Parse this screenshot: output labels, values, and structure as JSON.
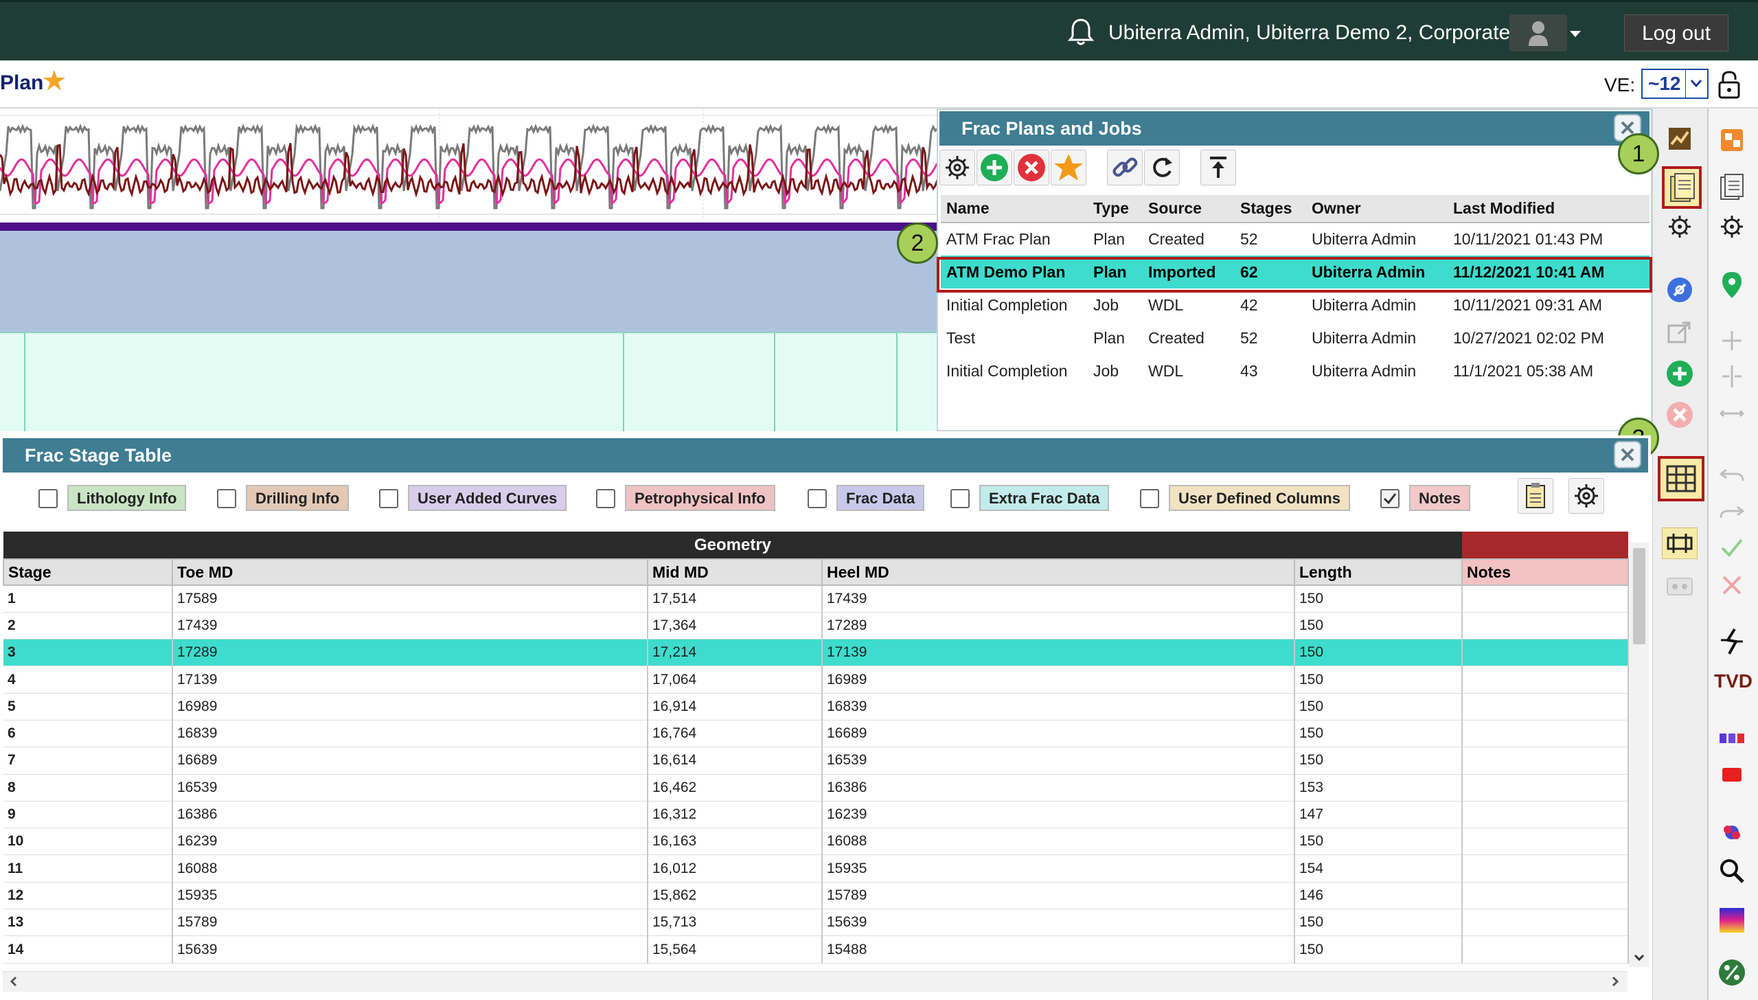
{
  "topbar": {
    "user": "Ubiterra Admin, Ubiterra Demo 2, Corporate",
    "logout_label": "Log out",
    "icons": [
      "bell-icon",
      "avatar-icon",
      "chevron-down-icon"
    ]
  },
  "titlebar": {
    "title": "Plan",
    "ve_label": "VE:",
    "ve_value": "~12"
  },
  "frac_plans": {
    "title": "Frac Plans and Jobs",
    "toolbar_icons": [
      "gear-icon",
      "add-icon",
      "delete-icon",
      "star-icon",
      "link-icon",
      "refresh-icon",
      "upload-icon"
    ],
    "columns": [
      "Name",
      "Type",
      "Source",
      "Stages",
      "Owner",
      "Last Modified"
    ],
    "rows": [
      [
        "ATM Frac Plan",
        "Plan",
        "Created",
        "52",
        "Ubiterra Admin",
        "10/11/2021 01:43 PM"
      ],
      [
        "ATM Demo Plan",
        "Plan",
        "Imported",
        "62",
        "Ubiterra Admin",
        "11/12/2021 10:41 AM"
      ],
      [
        "Initial Completion",
        "Job",
        "WDL",
        "42",
        "Ubiterra Admin",
        "10/11/2021 09:31 AM"
      ],
      [
        "Test",
        "Plan",
        "Created",
        "52",
        "Ubiterra Admin",
        "10/27/2021 02:02 PM"
      ],
      [
        "Initial Completion",
        "Job",
        "WDL",
        "43",
        "Ubiterra Admin",
        "11/1/2021 05:38 AM"
      ]
    ],
    "selected_row": 1
  },
  "callouts": [
    "1",
    "2",
    "3"
  ],
  "stage_table": {
    "title": "Frac Stage Table",
    "filters": [
      {
        "label": "Lithology Info",
        "checked": false,
        "color": "#c9e4c3"
      },
      {
        "label": "Drilling Info",
        "checked": false,
        "color": "#e3c9b5"
      },
      {
        "label": "User Added Curves",
        "checked": false,
        "color": "#d8cdea"
      },
      {
        "label": "Petrophysical Info",
        "checked": false,
        "color": "#efc3c3"
      },
      {
        "label": "Frac Data",
        "checked": false,
        "color": "#c8c9ea"
      },
      {
        "label": "Extra Frac Data",
        "checked": false,
        "color": "#c1ecea"
      },
      {
        "label": "User Defined Columns",
        "checked": false,
        "color": "#f1e3c1"
      },
      {
        "label": "Notes",
        "checked": true,
        "color": "#f3c8c8"
      }
    ],
    "group_header": "Geometry",
    "columns": [
      "Stage",
      "Toe MD",
      "Mid MD",
      "Heel MD",
      "Length",
      "Notes"
    ],
    "rows": [
      [
        "1",
        "17589",
        "17,514",
        "17439",
        "150",
        ""
      ],
      [
        "2",
        "17439",
        "17,364",
        "17289",
        "150",
        ""
      ],
      [
        "3",
        "17289",
        "17,214",
        "17139",
        "150",
        ""
      ],
      [
        "4",
        "17139",
        "17,064",
        "16989",
        "150",
        ""
      ],
      [
        "5",
        "16989",
        "16,914",
        "16839",
        "150",
        ""
      ],
      [
        "6",
        "16839",
        "16,764",
        "16689",
        "150",
        ""
      ],
      [
        "7",
        "16689",
        "16,614",
        "16539",
        "150",
        ""
      ],
      [
        "8",
        "16539",
        "16,462",
        "16386",
        "153",
        ""
      ],
      [
        "9",
        "16386",
        "16,312",
        "16239",
        "147",
        ""
      ],
      [
        "10",
        "16239",
        "16,163",
        "16088",
        "150",
        ""
      ],
      [
        "11",
        "16088",
        "16,012",
        "15935",
        "154",
        ""
      ],
      [
        "12",
        "15935",
        "15,862",
        "15789",
        "146",
        ""
      ],
      [
        "13",
        "15789",
        "15,713",
        "15639",
        "150",
        ""
      ],
      [
        "14",
        "15639",
        "15,564",
        "15488",
        "150",
        ""
      ]
    ],
    "selected_row": 2
  },
  "sidebar1_icons": [
    "map-icon",
    "document-icon",
    "gear-icon",
    "compass-icon",
    "export-icon",
    "add-icon",
    "delete-icon",
    "table-icon",
    "ruler-icon",
    "card-icon"
  ],
  "sidebar2_icons": [
    "stack-icon",
    "document-icon",
    "gear-icon",
    "pin-icon",
    "plus-icon",
    "split-icon",
    "resize-icon",
    "undo-icon",
    "redo-icon",
    "check-icon",
    "close-icon",
    "fault-icon",
    "tvd-icon",
    "bars-icon",
    "red-box-icon",
    "color-cube-icon",
    "magnify-icon",
    "gradient-icon",
    "percent-icon"
  ],
  "sidebar2_tvd": "TVD"
}
